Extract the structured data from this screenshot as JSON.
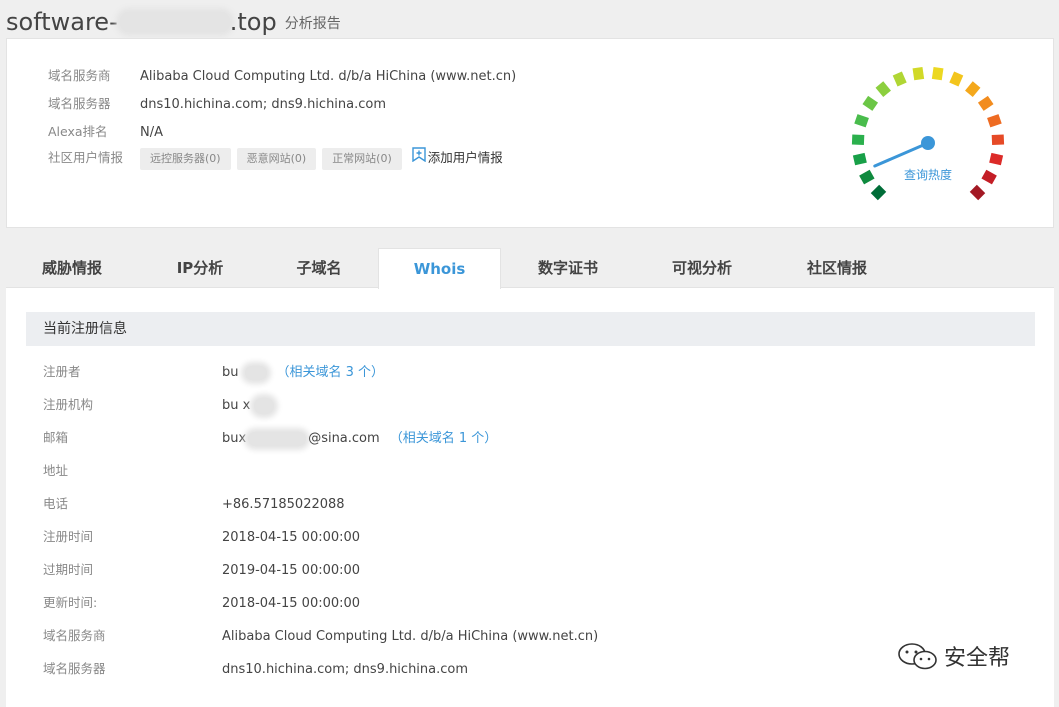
{
  "title": {
    "prefix": "software-",
    "suffix": ".top",
    "sub": "分析报告"
  },
  "summary": {
    "rows": [
      {
        "label": "域名服务商",
        "value": "Alibaba Cloud Computing Ltd. d/b/a HiChina (www.net.cn)"
      },
      {
        "label": "域名服务器",
        "value": "dns10.hichina.com; dns9.hichina.com"
      },
      {
        "label": "Alexa排名",
        "value": "N/A"
      }
    ],
    "community": {
      "label": "社区用户情报",
      "pills": [
        "远控服务器(0)",
        "恶意网站(0)",
        "正常网站(0)"
      ],
      "add_label": "添加用户情报",
      "add_icon": "bookmark-plus-icon"
    },
    "gauge": {
      "label": "查询热度",
      "level": 0.08
    }
  },
  "tabs": [
    "威胁情报",
    "IP分析",
    "子域名",
    "Whois",
    "数字证书",
    "可视分析",
    "社区情报"
  ],
  "active_tab": "Whois",
  "whois": {
    "section_title": "当前注册信息",
    "registrant": {
      "label": "注册者",
      "value": "bu",
      "related": "（相关域名 3 个）"
    },
    "org": {
      "label": "注册机构",
      "value": "bu x"
    },
    "email": {
      "label": "邮箱",
      "prefix": "bux",
      "suffix": "@sina.com",
      "related": "（相关域名 1 个）"
    },
    "rows": [
      {
        "label": "地址",
        "value": ""
      },
      {
        "label": "电话",
        "value": "+86.57185022088"
      },
      {
        "label": "注册时间",
        "value": "2018-04-15 00:00:00"
      },
      {
        "label": "过期时间",
        "value": "2019-04-15 00:00:00"
      },
      {
        "label": "更新时间:",
        "value": "2018-04-15 00:00:00"
      },
      {
        "label": "域名服务商",
        "value": "Alibaba Cloud Computing Ltd. d/b/a HiChina (www.net.cn)"
      },
      {
        "label": "域名服务器",
        "value": "dns10.hichina.com; dns9.hichina.com"
      }
    ]
  },
  "watermark": {
    "text": "安全帮",
    "icon": "wechat-icon"
  },
  "colors": {
    "accent": "#3b96d8"
  }
}
